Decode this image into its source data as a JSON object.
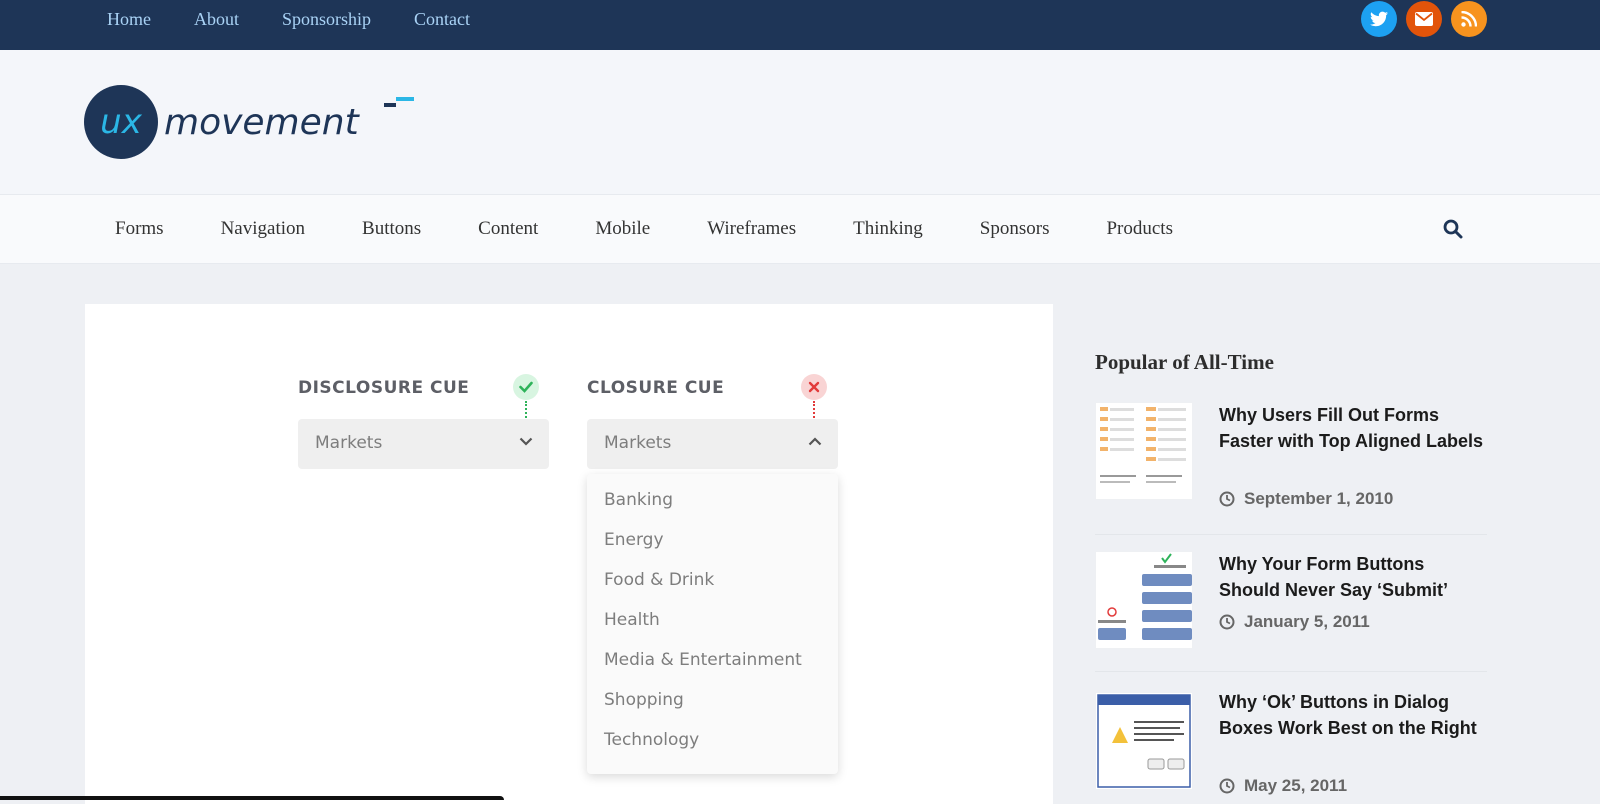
{
  "topnav": {
    "items": [
      "Home",
      "About",
      "Sponsorship",
      "Contact"
    ]
  },
  "social": {
    "twitter": {
      "icon": "twitter-icon",
      "color": "#1da1f2"
    },
    "email": {
      "icon": "envelope-icon",
      "color": "#e2540a"
    },
    "rss": {
      "icon": "rss-icon",
      "color": "#f7931e"
    }
  },
  "logo": {
    "ux": "ux",
    "word": "movement"
  },
  "catnav": {
    "items": [
      "Forms",
      "Navigation",
      "Buttons",
      "Content",
      "Mobile",
      "Wireframes",
      "Thinking",
      "Sponsors",
      "Products"
    ]
  },
  "article": {
    "disclosure": {
      "label": "DISCLOSURE CUE",
      "value": "Markets",
      "status_color": "#2eb35a"
    },
    "closure": {
      "label": "CLOSURE CUE",
      "value": "Markets",
      "status_color": "#e23b3b",
      "options": [
        "Banking",
        "Energy",
        "Food & Drink",
        "Health",
        "Media & Entertainment",
        "Shopping",
        "Technology"
      ]
    }
  },
  "sidebar": {
    "title": "Popular of All-Time",
    "posts": [
      {
        "title": "Why Users Fill Out Forms Faster with Top Aligned Labels",
        "date": "September 1, 2010"
      },
      {
        "title": "Why Your Form Buttons Should Never Say ‘Submit’",
        "date": "January 5, 2011"
      },
      {
        "title": "Why ‘Ok’ Buttons in Dialog Boxes Work Best on the Right",
        "date": "May 25, 2011"
      }
    ]
  },
  "colors": {
    "topbar": "#1e3557",
    "brand_blue": "#1e3557",
    "accent_cyan": "#2bb7e6"
  }
}
